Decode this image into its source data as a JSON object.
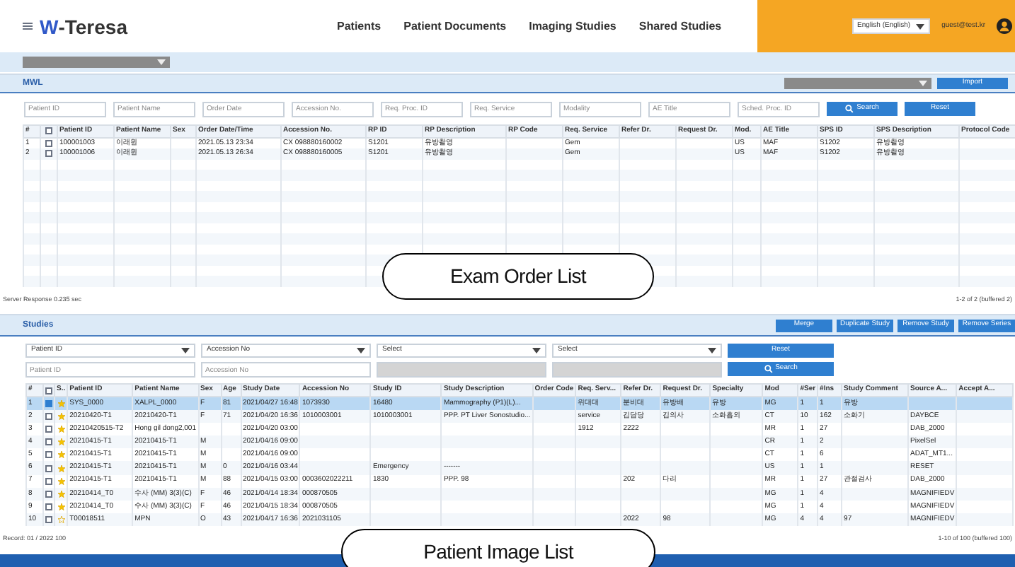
{
  "header": {
    "logo_mark": "W",
    "logo_text": "-Teresa",
    "nav": [
      "Patients",
      "Patient Documents",
      "Imaging Studies",
      "Shared Studies"
    ],
    "language": "English (English)",
    "user": "guest@test.kr"
  },
  "mwl": {
    "title": "MWL",
    "import_button": "Import",
    "filters": [
      {
        "placeholder": "Patient ID"
      },
      {
        "placeholder": "Patient Name"
      },
      {
        "placeholder": "Order Date"
      },
      {
        "placeholder": "Accession No."
      },
      {
        "placeholder": "Req. Proc. ID"
      },
      {
        "placeholder": "Req. Service"
      },
      {
        "placeholder": "Modality"
      },
      {
        "placeholder": "AE Title"
      },
      {
        "placeholder": "Sched. Proc. ID"
      }
    ],
    "header_checked": false,
    "search_button": "Search",
    "reset_button": "Reset",
    "columns": [
      "#",
      "",
      "Patient ID",
      "Patient Name",
      "Sex",
      "Order Date/Time",
      "Accession No.",
      "RP ID",
      "RP Description",
      "RP Code",
      "Req. Service",
      "Refer Dr.",
      "Request Dr.",
      "Mod.",
      "AE Title",
      "SPS ID",
      "SPS Description",
      "Protocol Code"
    ],
    "rows": [
      {
        "checked": false,
        "cells": [
          "1",
          "",
          "100001003",
          "이래원",
          "",
          "2021.05.13 23:34",
          "CX 098880160002",
          "S1201",
          "유방촬영",
          "",
          "Gem",
          "",
          "",
          "US",
          "MAF",
          "S1202",
          "유방촬영",
          ""
        ]
      },
      {
        "checked": false,
        "cells": [
          "2",
          "",
          "100001006",
          "이래원",
          "",
          "2021.05.13 26:34",
          "CX 098880160005",
          "S1201",
          "유방촬영",
          "",
          "Gem",
          "",
          "",
          "US",
          "MAF",
          "S1202",
          "유방촬영",
          ""
        ]
      }
    ],
    "status": "Server Response 0.235 sec",
    "paging": "1-2 of 2 (buffered 2)",
    "callout": "Exam Order List"
  },
  "studies": {
    "title": "Studies",
    "buttons": [
      "Merge",
      "Duplicate Study",
      "Remove Study",
      "Remove Series"
    ],
    "filter_selects": [
      "Patient ID",
      "Accession No",
      "Select",
      "Select"
    ],
    "reset_button": "Reset",
    "filter_inputs": [
      {
        "placeholder": "Patient ID",
        "disabled": false
      },
      {
        "placeholder": "Accession No",
        "disabled": false
      },
      {
        "disabled": true
      },
      {
        "disabled": true
      }
    ],
    "search_button": "Search",
    "header_checked": false,
    "columns": [
      "#",
      "",
      "S..",
      "Patient ID",
      "Patient Name",
      "Sex",
      "Age",
      "Study Date",
      "Accession No",
      "Study ID",
      "Study Description",
      "Order Code",
      "Req. Serv...",
      "Refer Dr.",
      "Request Dr.",
      "Specialty",
      "Mod",
      "#Ser",
      "#Ins",
      "Study Comment",
      "Source A...",
      "Accept A..."
    ],
    "rows": [
      {
        "selected": true,
        "checked": true,
        "starred": true,
        "cells": [
          "1",
          "",
          "",
          "SYS_0000",
          "XALPL_0000",
          "F",
          "81",
          "2021/04/27 16:48",
          "1073930",
          "16480",
          "Mammography (P1)(L)...",
          "",
          "위대대",
          "분비대",
          "유방배",
          "유방",
          "MG",
          "1",
          "1",
          "유방",
          "",
          ""
        ]
      },
      {
        "selected": false,
        "checked": false,
        "starred": true,
        "cells": [
          "2",
          "",
          "",
          "20210420-T1",
          "20210420-T1",
          "F",
          "71",
          "2021/04/20 16:36",
          "1010003001",
          "1010003001",
          "PPP. PT Liver Sonostudio...",
          "",
          "service",
          "김담당",
          "김의사",
          "소화흡외",
          "CT",
          "10",
          "162",
          "소화기",
          "DAYBCE",
          ""
        ]
      },
      {
        "selected": false,
        "checked": false,
        "starred": true,
        "cells": [
          "3",
          "",
          "",
          "20210420515-T2",
          "Hong gil dong2,001",
          "",
          "",
          "2021/04/20 03:00",
          "",
          "",
          "",
          "",
          "1912",
          "2222",
          "",
          "",
          "MR",
          "1",
          "27",
          "",
          "DAB_2000",
          ""
        ]
      },
      {
        "selected": false,
        "checked": false,
        "starred": true,
        "cells": [
          "4",
          "",
          "",
          "20210415-T1",
          "20210415-T1",
          "M",
          "",
          "2021/04/16 09:00",
          "",
          "",
          "",
          "",
          "",
          "",
          "",
          "",
          "CR",
          "1",
          "2",
          "",
          "PixelSel",
          ""
        ]
      },
      {
        "selected": false,
        "checked": false,
        "starred": true,
        "cells": [
          "5",
          "",
          "",
          "20210415-T1",
          "20210415-T1",
          "M",
          "",
          "2021/04/16 09:00",
          "",
          "",
          "",
          "",
          "",
          "",
          "",
          "",
          "CT",
          "1",
          "6",
          "",
          "ADAT_MT1...",
          ""
        ]
      },
      {
        "selected": false,
        "checked": false,
        "starred": true,
        "cells": [
          "6",
          "",
          "",
          "20210415-T1",
          "20210415-T1",
          "M",
          "0",
          "2021/04/16 03:44",
          "",
          "Emergency",
          "-------",
          "",
          "",
          "",
          "",
          "",
          "US",
          "1",
          "1",
          "",
          "RESET",
          ""
        ]
      },
      {
        "selected": false,
        "checked": false,
        "starred": true,
        "cells": [
          "7",
          "",
          "",
          "20210415-T1",
          "20210415-T1",
          "M",
          "88",
          "2021/04/15 03:00",
          "0003602022211",
          "1830",
          "PPP. 98",
          "",
          "",
          "202",
          "다리",
          "",
          "MR",
          "1",
          "27",
          "관절검사",
          "DAB_2000",
          ""
        ]
      },
      {
        "selected": false,
        "checked": false,
        "starred": true,
        "cells": [
          "8",
          "",
          "",
          "20210414_T0",
          "수사 (MM) 3(3)(C)",
          "F",
          "46",
          "2021/04/14 18:34",
          "000870505",
          "",
          "",
          "",
          "",
          "",
          "",
          "",
          "MG",
          "1",
          "4",
          "",
          "MAGNIFIEDV",
          ""
        ]
      },
      {
        "selected": false,
        "checked": false,
        "starred": true,
        "cells": [
          "9",
          "",
          "",
          "20210414_T0",
          "수사 (MM) 3(3)(C)",
          "F",
          "46",
          "2021/04/15 18:34",
          "000870505",
          "",
          "",
          "",
          "",
          "",
          "",
          "",
          "MG",
          "1",
          "4",
          "",
          "MAGNIFIEDV",
          ""
        ]
      },
      {
        "selected": false,
        "checked": false,
        "starred": false,
        "cells": [
          "10",
          "",
          "",
          "T00018511",
          "MPN",
          "O",
          "43",
          "2021/04/17 16:36",
          "2021031105",
          "",
          "",
          "",
          "",
          "2022",
          "98",
          "",
          "MG",
          "4",
          "4",
          "97",
          "MAGNIFIEDV",
          ""
        ]
      }
    ],
    "record": "Record: 01 / 2022 100",
    "paging": "1-10 of 100 (buffered 100)",
    "callout": "Patient Image List"
  }
}
